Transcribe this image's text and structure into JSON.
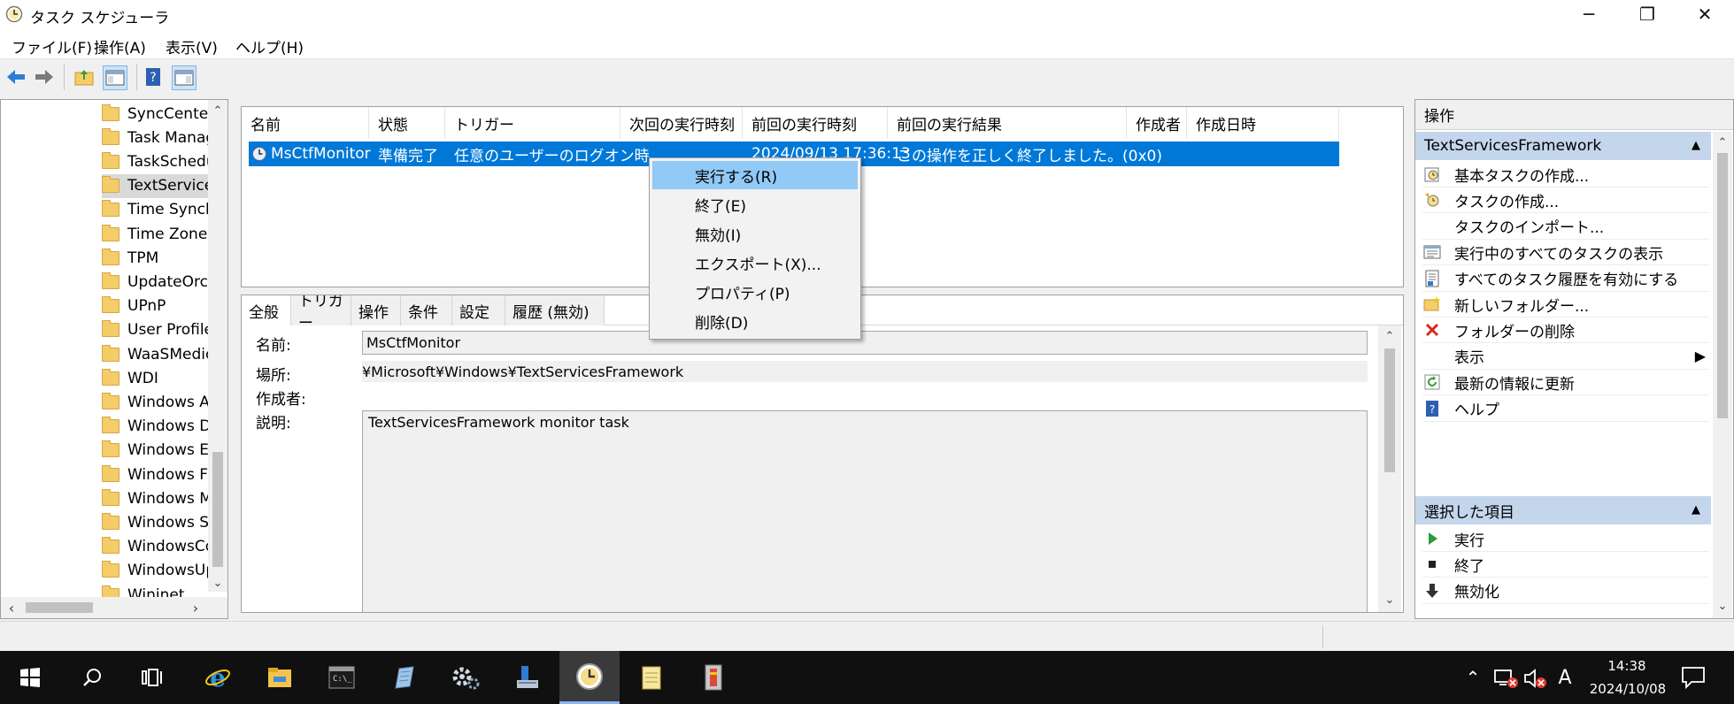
{
  "window": {
    "title": "タスク スケジューラ",
    "minimize": "─",
    "restore": "❐",
    "close": "✕"
  },
  "menu": [
    "ファイル(F)",
    "操作(A)",
    "表示(V)",
    "ヘルプ(H)"
  ],
  "tree": {
    "items": [
      "SyncCenter",
      "Task Manager",
      "TaskScheduler",
      "TextServicesFramework",
      "Time Synchronization",
      "Time Zone",
      "TPM",
      "UpdateOrchestrator",
      "UPnP",
      "User Profile Service",
      "WaaSMedic",
      "WDI",
      "Windows Activation",
      "Windows Defender",
      "Windows Error Reporting",
      "Windows Filtering",
      "Windows Media Sharing",
      "Windows Subsystem",
      "WindowsColorSystem",
      "WindowsUpdate",
      "Wininet"
    ],
    "selected_index": 3
  },
  "tasklist": {
    "columns": [
      "名前",
      "状態",
      "トリガー",
      "次回の実行時刻",
      "前回の実行時刻",
      "前回の実行結果",
      "作成者",
      "作成日時"
    ],
    "row": {
      "name": "MsCtfMonitor",
      "status": "準備完了",
      "trigger": "任意のユーザーのログオン時",
      "next_run": "",
      "last_run": "2024/09/13 17:36:13",
      "last_result": "この操作を正しく終了しました。(0x0)",
      "author": "",
      "created": ""
    }
  },
  "context_menu": {
    "items": [
      "実行する(R)",
      "終了(E)",
      "無効(I)",
      "エクスポート(X)...",
      "プロパティ(P)",
      "削除(D)"
    ],
    "highlighted_index": 0
  },
  "detail": {
    "tabs": [
      "全般",
      "トリガー",
      "操作",
      "条件",
      "設定",
      "履歴 (無効)"
    ],
    "active_tab": 0,
    "name_label": "名前:",
    "name_value": "MsCtfMonitor",
    "location_label": "場所:",
    "location_value": "¥Microsoft¥Windows¥TextServicesFramework",
    "author_label": "作成者:",
    "author_value": "",
    "description_label": "説明:",
    "description_value": "TextServicesFramework monitor task"
  },
  "actions": {
    "title": "操作",
    "section1": "TextServicesFramework",
    "items1": [
      {
        "label": "基本タスクの作成...",
        "icon": "basic-task-icon"
      },
      {
        "label": "タスクの作成...",
        "icon": "create-task-icon"
      },
      {
        "label": "タスクのインポート...",
        "icon": ""
      },
      {
        "label": "実行中のすべてのタスクの表示",
        "icon": "running-tasks-icon"
      },
      {
        "label": "すべてのタスク履歴を有効にする",
        "icon": "history-icon"
      },
      {
        "label": "新しいフォルダー...",
        "icon": "new-folder-icon"
      },
      {
        "label": "フォルダーの削除",
        "icon": "delete-icon"
      },
      {
        "label": "表示",
        "icon": ""
      },
      {
        "label": "最新の情報に更新",
        "icon": "refresh-icon"
      },
      {
        "label": "ヘルプ",
        "icon": "help-icon"
      }
    ],
    "section2": "選択した項目",
    "items2": [
      {
        "label": "実行",
        "icon": "run-icon"
      },
      {
        "label": "終了",
        "icon": "stop-icon"
      },
      {
        "label": "無効化",
        "icon": "disable-icon"
      }
    ]
  },
  "taskbar": {
    "apps": [
      "start",
      "search",
      "task-view",
      "internet-explorer",
      "file-explorer",
      "command-prompt",
      "notepad-feather",
      "services",
      "server-manager",
      "task-scheduler",
      "notepad",
      "archive"
    ],
    "time": "14:38",
    "date": "2024/10/08",
    "ime": "A"
  },
  "colors": {
    "selection": "#0078d7",
    "context_hover": "#91c9f7",
    "action_header": "#c3d6ec",
    "taskbar": "#101010"
  }
}
